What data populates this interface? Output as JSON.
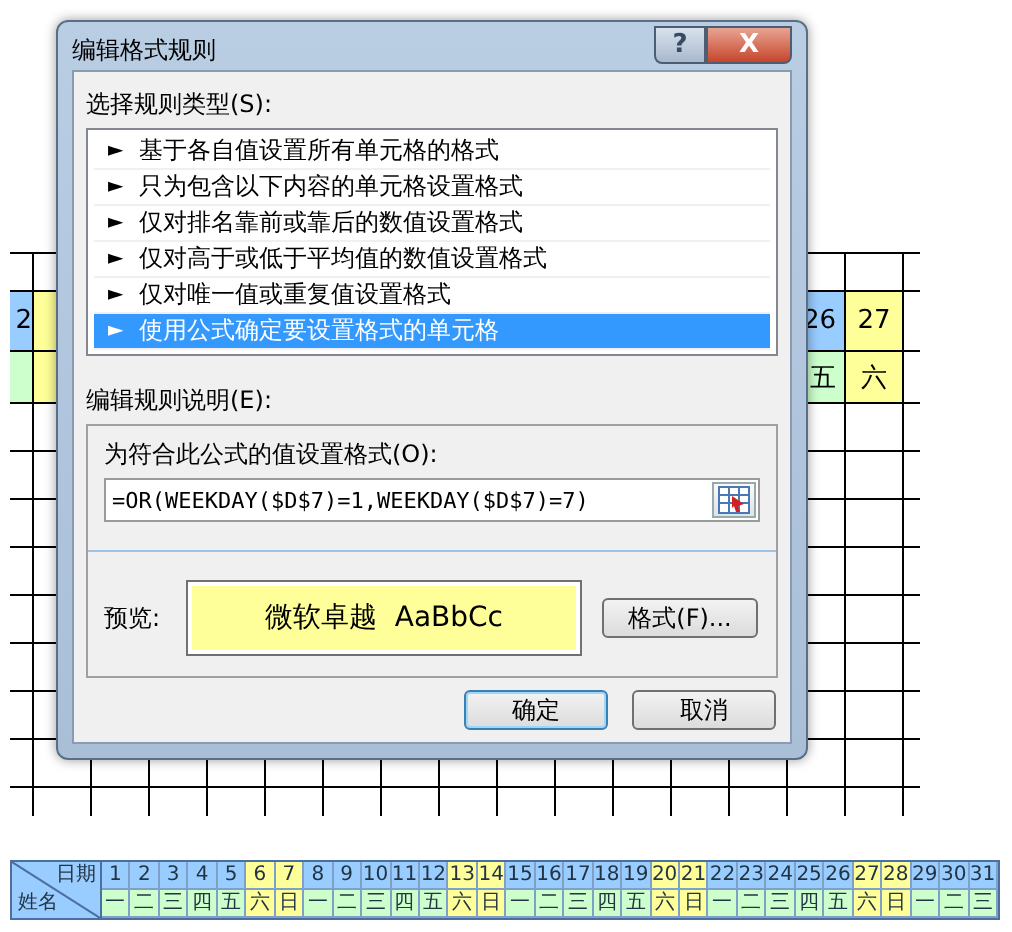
{
  "sheet": {
    "rows": [
      {
        "left": [
          {
            "text": "2",
            "color": "#99ccff"
          },
          {
            "color": "#ffff99"
          }
        ],
        "right": [
          {
            "text": "26",
            "color": "#99ccff"
          },
          {
            "text": "27",
            "color": "#ffff99"
          }
        ]
      },
      {
        "left": [
          {
            "color": "#ccffcc"
          },
          {
            "color": "#ffff99"
          }
        ],
        "right": [
          {
            "text": "五",
            "color": "#ccffcc"
          },
          {
            "text": "六",
            "color": "#ffff99"
          }
        ]
      }
    ]
  },
  "dialog": {
    "title": "编辑格式规则",
    "help_button": "?",
    "close_button": "X",
    "rule_type_label": "选择规则类型(S):",
    "rule_types": [
      {
        "arrow": "►",
        "label": "基于各自值设置所有单元格的格式",
        "selected": false
      },
      {
        "arrow": "►",
        "label": "只为包含以下内容的单元格设置格式",
        "selected": false
      },
      {
        "arrow": "►",
        "label": "仅对排名靠前或靠后的数值设置格式",
        "selected": false
      },
      {
        "arrow": "►",
        "label": "仅对高于或低于平均值的数值设置格式",
        "selected": false
      },
      {
        "arrow": "►",
        "label": "仅对唯一值或重复值设置格式",
        "selected": false
      },
      {
        "arrow": "►",
        "label": "使用公式确定要设置格式的单元格",
        "selected": true
      }
    ],
    "description_label": "编辑规则说明(E):",
    "formula_label": "为符合此公式的值设置格式(O):",
    "formula": "=OR(WEEKDAY($D$7)=1,WEEKDAY($D$7)=7)",
    "preview_label": "预览:",
    "preview_text": "微软卓越  AaBbCc",
    "format_button": "格式(F)...",
    "ok_button": "确定",
    "cancel_button": "取消"
  },
  "calendar": {
    "date_header": "日期",
    "name_header": "姓名",
    "days": [
      {
        "day": "1",
        "weekday": "一",
        "weekend": false
      },
      {
        "day": "2",
        "weekday": "二",
        "weekend": false
      },
      {
        "day": "3",
        "weekday": "三",
        "weekend": false
      },
      {
        "day": "4",
        "weekday": "四",
        "weekend": false
      },
      {
        "day": "5",
        "weekday": "五",
        "weekend": false
      },
      {
        "day": "6",
        "weekday": "六",
        "weekend": true
      },
      {
        "day": "7",
        "weekday": "日",
        "weekend": true
      },
      {
        "day": "8",
        "weekday": "一",
        "weekend": false
      },
      {
        "day": "9",
        "weekday": "二",
        "weekend": false
      },
      {
        "day": "10",
        "weekday": "三",
        "weekend": false
      },
      {
        "day": "11",
        "weekday": "四",
        "weekend": false
      },
      {
        "day": "12",
        "weekday": "五",
        "weekend": false
      },
      {
        "day": "13",
        "weekday": "六",
        "weekend": true
      },
      {
        "day": "14",
        "weekday": "日",
        "weekend": true
      },
      {
        "day": "15",
        "weekday": "一",
        "weekend": false
      },
      {
        "day": "16",
        "weekday": "二",
        "weekend": false
      },
      {
        "day": "17",
        "weekday": "三",
        "weekend": false
      },
      {
        "day": "18",
        "weekday": "四",
        "weekend": false
      },
      {
        "day": "19",
        "weekday": "五",
        "weekend": false
      },
      {
        "day": "20",
        "weekday": "六",
        "weekend": true
      },
      {
        "day": "21",
        "weekday": "日",
        "weekend": true
      },
      {
        "day": "22",
        "weekday": "一",
        "weekend": false
      },
      {
        "day": "23",
        "weekday": "二",
        "weekend": false
      },
      {
        "day": "24",
        "weekday": "三",
        "weekend": false
      },
      {
        "day": "25",
        "weekday": "四",
        "weekend": false
      },
      {
        "day": "26",
        "weekday": "五",
        "weekend": false
      },
      {
        "day": "27",
        "weekday": "六",
        "weekend": true
      },
      {
        "day": "28",
        "weekday": "日",
        "weekend": true
      },
      {
        "day": "29",
        "weekday": "一",
        "weekend": false
      },
      {
        "day": "30",
        "weekday": "二",
        "weekend": false
      },
      {
        "day": "31",
        "weekday": "三",
        "weekend": false
      }
    ]
  }
}
